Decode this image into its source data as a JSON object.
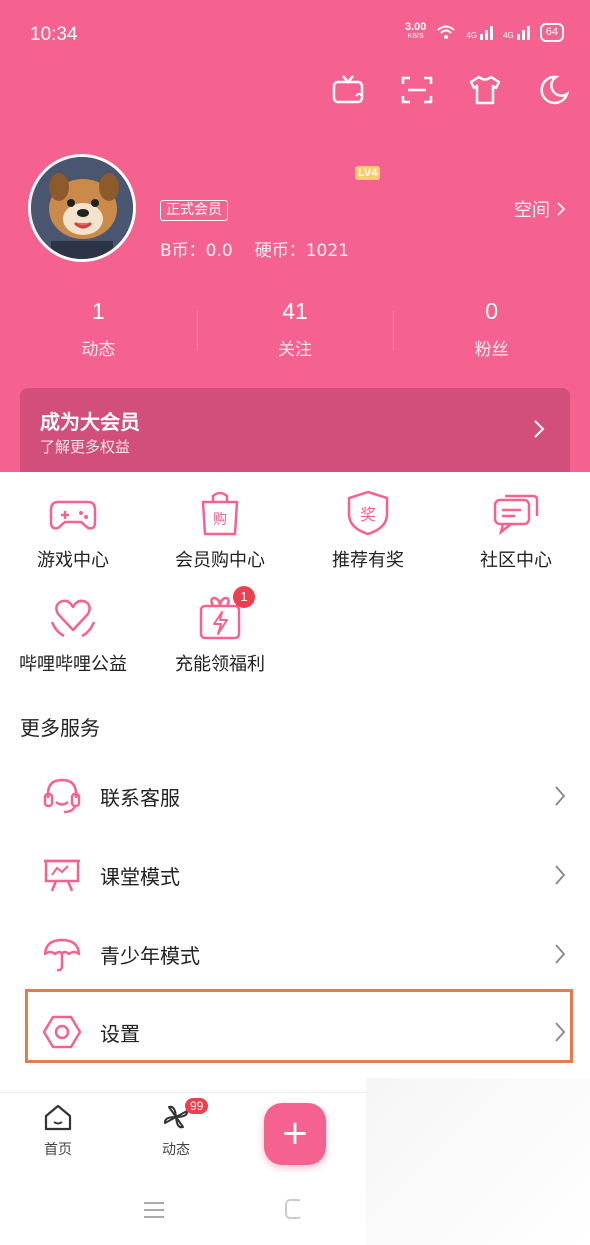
{
  "status_bar": {
    "time": "10:34",
    "speed": "3.00",
    "speed_unit": "KB/S",
    "net1": "4G",
    "net2": "4G",
    "battery": "64"
  },
  "header_icons": [
    "tv-icon",
    "scan-icon",
    "shirt-icon",
    "moon-icon"
  ],
  "profile": {
    "level": "LV4",
    "member_badge": "正式会员",
    "space_label": "空间",
    "bcoin": "B币：0.0",
    "coins": "硬币：1021"
  },
  "stats": [
    {
      "num": "1",
      "label": "动态"
    },
    {
      "num": "41",
      "label": "关注"
    },
    {
      "num": "0",
      "label": "粉丝"
    }
  ],
  "vip": {
    "title": "成为大会员",
    "subtitle": "了解更多权益"
  },
  "grid": [
    {
      "label": "游戏中心",
      "icon": "gamepad-icon"
    },
    {
      "label": "会员购中心",
      "icon": "shopping-bag-icon"
    },
    {
      "label": "推荐有奖",
      "icon": "award-shield-icon"
    },
    {
      "label": "社区中心",
      "icon": "chat-bubbles-icon"
    },
    {
      "label": "哔哩哔哩公益",
      "icon": "heart-hands-icon"
    },
    {
      "label": "充能领福利",
      "icon": "gift-bolt-icon",
      "badge": "1"
    }
  ],
  "more_services": {
    "title": "更多服务",
    "items": [
      {
        "label": "联系客服",
        "icon": "headset-icon"
      },
      {
        "label": "课堂模式",
        "icon": "board-icon"
      },
      {
        "label": "青少年模式",
        "icon": "umbrella-icon"
      },
      {
        "label": "设置",
        "icon": "settings-hexagon-icon"
      }
    ]
  },
  "tabbar": {
    "home": "首页",
    "feed": "动态",
    "feed_badge": "99",
    "plus": "+"
  },
  "colors": {
    "brand": "#f6628f",
    "vip": "#d24f7b",
    "highlight": "#e8794f",
    "badge": "#ee3f4e"
  }
}
